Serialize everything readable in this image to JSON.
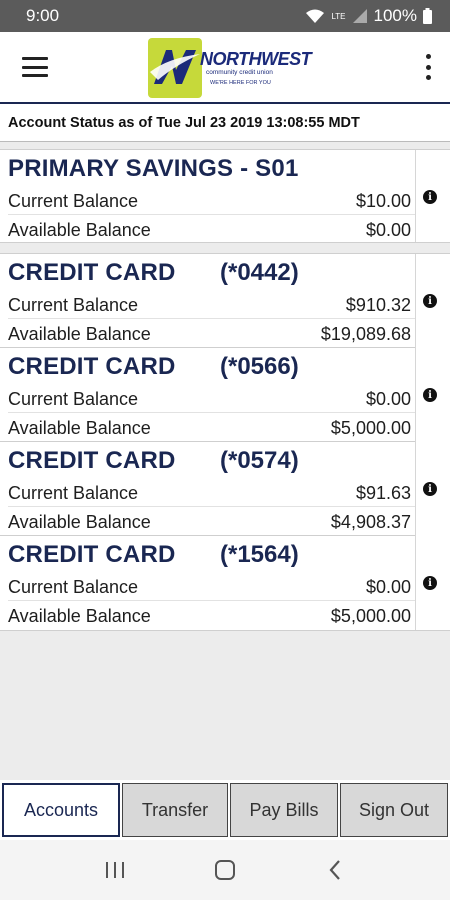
{
  "status_bar": {
    "time": "9:00",
    "network": "LTE",
    "battery": "100%"
  },
  "header": {
    "logo": {
      "name": "NORTHWEST",
      "subtitle": "community credit union",
      "tagline": "WE'RE HERE FOR YOU"
    }
  },
  "account_status": "Account Status as of Tue Jul 23 2019 13:08:55 MDT",
  "labels": {
    "current": "Current Balance",
    "available": "Available Balance"
  },
  "savings": {
    "title": "PRIMARY SAVINGS - S01",
    "current": "$10.00",
    "available": "$0.00"
  },
  "credit_cards": [
    {
      "title": "CREDIT CARD",
      "number": "(*0442)",
      "current": "$910.32",
      "available": "$19,089.68"
    },
    {
      "title": "CREDIT CARD",
      "number": "(*0566)",
      "current": "$0.00",
      "available": "$5,000.00"
    },
    {
      "title": "CREDIT CARD",
      "number": "(*0574)",
      "current": "$91.63",
      "available": "$4,908.37"
    },
    {
      "title": "CREDIT CARD",
      "number": "(*1564)",
      "current": "$0.00",
      "available": "$5,000.00"
    }
  ],
  "tabs": {
    "accounts": "Accounts",
    "transfer": "Transfer",
    "pay_bills": "Pay Bills",
    "sign_out": "Sign Out"
  },
  "colors": {
    "brand_navy": "#1a2752",
    "brand_lime": "#c6d93a",
    "status_bar": "#5b5b5b"
  }
}
